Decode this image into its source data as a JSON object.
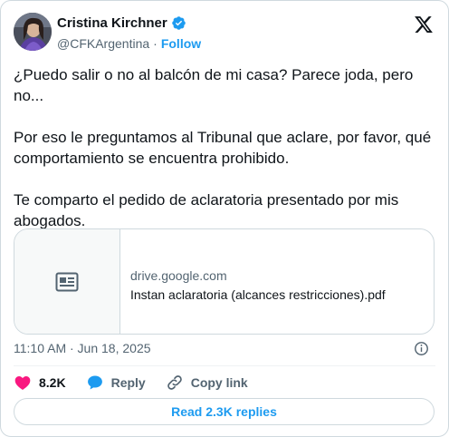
{
  "author": {
    "name": "Cristina Kirchner",
    "handle": "@CFKArgentina",
    "separator": "·",
    "follow_label": "Follow"
  },
  "tweet": {
    "text": "¿Puedo salir o no al balcón de mi casa? Parece joda, pero no...\n\nPor eso le preguntamos al Tribunal que aclare, por favor, qué comportamiento se encuentra prohibido.\n\nTe comparto el pedido de aclaratoria presentado por mis abogados."
  },
  "link_card": {
    "domain": "drive.google.com",
    "title": "Instan aclaratoria (alcances restricciones).pdf",
    "thumb_icon": "article-icon"
  },
  "meta": {
    "timestamp": "11:10 AM · Jun 18, 2025"
  },
  "actions": {
    "likes": "8.2K",
    "reply_label": "Reply",
    "copy_link_label": "Copy link"
  },
  "replies_button": "Read 2.3K replies",
  "colors": {
    "accent": "#1d9bf0",
    "like": "#f91880",
    "text": "#0f1419",
    "secondary": "#536471",
    "border": "#cfd9de"
  }
}
